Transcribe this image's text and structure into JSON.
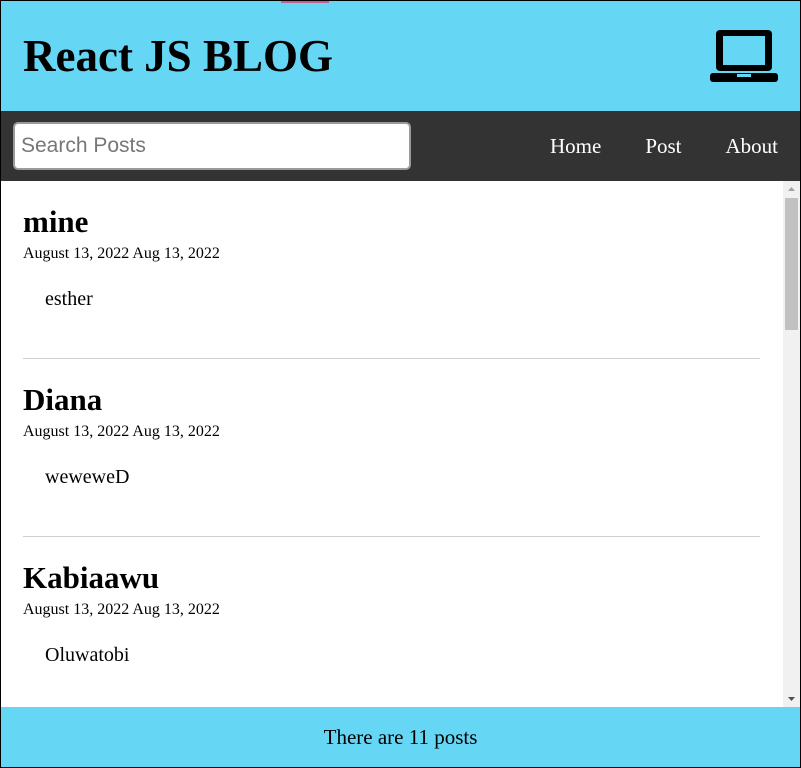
{
  "header": {
    "title": "React JS BLOG",
    "icon": "laptop-icon",
    "background": "#66d6f5"
  },
  "nav": {
    "search": {
      "placeholder": "Search Posts",
      "value": ""
    },
    "links": [
      "Home",
      "Post",
      "About"
    ],
    "background": "#333333"
  },
  "posts": [
    {
      "title": "mine",
      "date": "August 13, 2022 Aug 13, 2022",
      "body": "esther"
    },
    {
      "title": "Diana",
      "date": "August 13, 2022 Aug 13, 2022",
      "body": "weweweD"
    },
    {
      "title": "Kabiaawu",
      "date": "August 13, 2022 Aug 13, 2022",
      "body": "Oluwatobi"
    }
  ],
  "footer": {
    "text": "There are 11 posts",
    "background": "#66d6f5"
  }
}
